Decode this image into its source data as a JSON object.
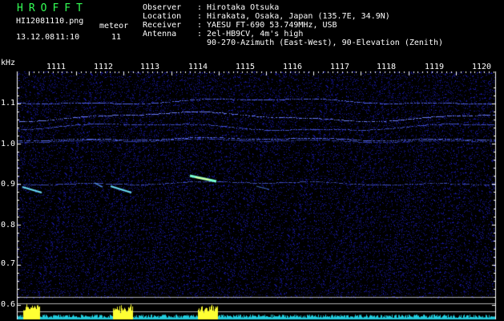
{
  "header": {
    "logo": "HROFFT",
    "filename": "HI12081110.png",
    "date": "13.12.08",
    "time": "11:10",
    "meteor_label": "meteor",
    "meteor_count": "11"
  },
  "info": [
    {
      "key": "Observer",
      "value": "Hirotaka Otsuka"
    },
    {
      "key": "Location",
      "value": "Hirakata, Osaka, Japan (135.7E, 34.9N)"
    },
    {
      "key": "Receiver",
      "value": "YAESU FT-690 53.749MHz, USB"
    },
    {
      "key": "Antenna",
      "value": "2el-HB9CV, 4m's high"
    },
    {
      "key": "",
      "value": "90-270-Azimuth (East-West), 90-Elevation (Zenith)"
    }
  ],
  "axis": {
    "y_unit": "kHz",
    "y_ticks": [
      "1.1",
      "1.0",
      "0.9",
      "0.8",
      "0.7",
      "0.6"
    ],
    "x_ticks": [
      "1111",
      "1112",
      "1113",
      "1114",
      "1115",
      "1116",
      "1117",
      "1118",
      "1119",
      "1120"
    ]
  },
  "colors": {
    "logo": "#33ff55",
    "text": "#ffffff",
    "background": "#000000",
    "noise": "#1a1aa0",
    "echo": "#66ffcc",
    "signal_yellow": "#ffff33"
  }
}
